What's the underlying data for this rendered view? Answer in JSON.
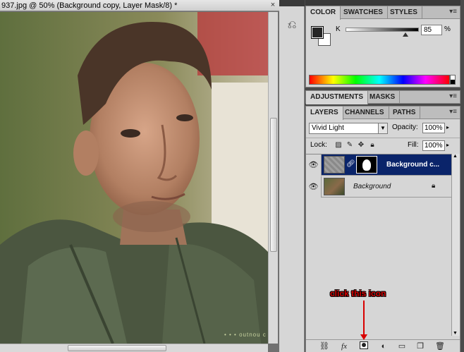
{
  "document": {
    "title": "937.jpg @ 50% (Background copy, Layer Mask/8) *",
    "close_glyph": "×",
    "watermark": "• • • outnou c"
  },
  "panels_strip": {
    "history_icon": "history-brush-icon"
  },
  "color_panel": {
    "tabs": [
      "COLOR",
      "SWATCHES",
      "STYLES"
    ],
    "channel_label": "K",
    "channel_value": "85",
    "unit": "%",
    "foreground_color": "#262626",
    "background_color": "#ffffff"
  },
  "adjustments_panel": {
    "tabs": [
      "ADJUSTMENTS",
      "MASKS"
    ]
  },
  "layers_panel": {
    "tabs": [
      "LAYERS",
      "CHANNELS",
      "PATHS"
    ],
    "blend_mode": "Vivid Light",
    "opacity_label": "Opacity:",
    "opacity_value": "100%",
    "lock_label": "Lock:",
    "fill_label": "Fill:",
    "fill_value": "100%",
    "layers": [
      {
        "name": "Background c...",
        "selected": true,
        "visible": true
      },
      {
        "name": "Background",
        "selected": false,
        "visible": true,
        "locked": true
      }
    ],
    "bottom_icons": [
      "link-icon",
      "fx-icon",
      "layer-mask-icon",
      "adjustment-layer-icon",
      "group-folder-icon",
      "new-layer-icon",
      "trash-icon"
    ]
  },
  "annotation": {
    "text": "click this icon",
    "color": "#d80000"
  },
  "colors": {
    "selected_layer": "#0a246a",
    "panel_bg": "#d6d6d6"
  }
}
